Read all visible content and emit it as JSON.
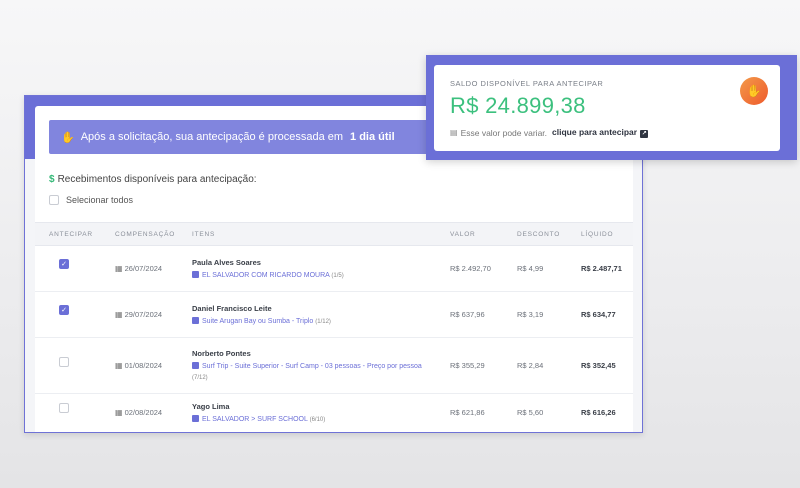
{
  "banner": {
    "text": "Após a solicitação, sua antecipação é processada em",
    "bold": "1 dia útil"
  },
  "section_title": "Recebimentos disponíveis para antecipação:",
  "select_all_label": "Selecionar todos",
  "table": {
    "headers": [
      "ANTECIPAR",
      "COMPENSAÇÃO",
      "ITENS",
      "VALOR",
      "DESCONTO",
      "LÍQUIDO"
    ],
    "rows": [
      {
        "checked": true,
        "date": "26/07/2024",
        "name": "Paula Alves Soares",
        "item": "EL SALVADOR COM RICARDO MOURA",
        "item_frac": "(1/5)",
        "valor": "R$ 2.492,70",
        "desconto": "R$ 4,99",
        "liquido": "R$ 2.487,71"
      },
      {
        "checked": true,
        "date": "29/07/2024",
        "name": "Daniel Francisco Leite",
        "item": "Suite Arugan Bay ou Sumba - Triplo",
        "item_frac": "(1/12)",
        "valor": "R$ 637,96",
        "desconto": "R$ 3,19",
        "liquido": "R$ 634,77"
      },
      {
        "checked": false,
        "date": "01/08/2024",
        "name": "Norberto Pontes",
        "item": "Surf Trip - Suite Superior - Surf Camp - 03 pessoas - Preço por pessoa",
        "item_frac": "(7/12)",
        "valor": "R$ 355,29",
        "desconto": "R$ 2,84",
        "liquido": "R$ 352,45"
      },
      {
        "checked": false,
        "date": "02/08/2024",
        "name": "Yago Lima",
        "item": "EL SALVADOR > SURF SCHOOL",
        "item_frac": "(6/10)",
        "valor": "R$ 621,86",
        "desconto": "R$ 5,60",
        "liquido": "R$ 616,26"
      }
    ]
  },
  "balance": {
    "label": "SALDO DISPONÍVEL PARA ANTECIPAR",
    "value": "R$ 24.899,38",
    "note": "Esse valor pode variar.",
    "link": "clique para antecipar"
  },
  "colors": {
    "accent": "#6b6fd7",
    "positive": "#3cc07e",
    "icon_orange": "#ee5a2c"
  },
  "icons": {
    "banner": "hand-coin-icon",
    "balance": "hand-coin-icon",
    "calendar": "calendar-icon",
    "note": "list-icon",
    "link": "external-link-icon"
  }
}
